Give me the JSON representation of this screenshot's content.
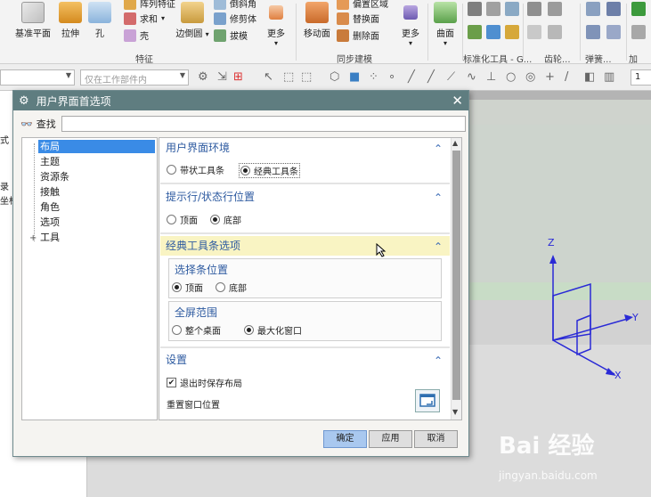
{
  "ribbon": {
    "feature_group": {
      "label": "特征",
      "buttons": [
        "基准平面",
        "拉伸",
        "孔",
        "边倒圆",
        "更多"
      ],
      "small_buttons": [
        "阵列特征",
        "求和",
        "壳",
        "倒斜角",
        "修剪体",
        "拔模"
      ]
    },
    "sync_group": {
      "label": "同步建模",
      "buttons": [
        "移动面",
        "更多"
      ],
      "small_buttons": [
        "偏置区域",
        "替换面",
        "删除面"
      ]
    },
    "surface_group": {
      "buttons": [
        "曲面"
      ]
    },
    "other_groups": [
      "标准化工具 - G...",
      "齿轮...",
      "弹簧...",
      "加工..."
    ]
  },
  "toolbar2": {
    "filter_combo": "",
    "scope_combo": "仅在工作部件内",
    "right_field": "1"
  },
  "left_panel": {
    "fragments": [
      "式",
      "录",
      "坐标"
    ]
  },
  "dialog": {
    "title": "用户界面首选项",
    "find_label": "查找",
    "find_value": "",
    "tree": [
      {
        "label": "布局",
        "selected": true
      },
      {
        "label": "主题",
        "selected": false
      },
      {
        "label": "资源条",
        "selected": false
      },
      {
        "label": "接触",
        "selected": false
      },
      {
        "label": "角色",
        "selected": false
      },
      {
        "label": "选项",
        "selected": false
      },
      {
        "label": "工具",
        "selected": false,
        "expandable": true
      }
    ],
    "sections": {
      "ui_env": {
        "title": "用户界面环境",
        "options": [
          "带状工具条",
          "经典工具条"
        ],
        "selected": "经典工具条"
      },
      "prompt": {
        "title": "提示行/状态行位置",
        "options": [
          "顶面",
          "底部"
        ],
        "selected": "底部"
      },
      "classic": {
        "title": "经典工具条选项",
        "selection_bar": {
          "title": "选择条位置",
          "options": [
            "顶面",
            "底部"
          ],
          "selected": "顶面"
        },
        "fullscreen": {
          "title": "全屏范围",
          "options": [
            "整个桌面",
            "最大化窗口"
          ],
          "selected": "最大化窗口"
        }
      },
      "settings": {
        "title": "设置",
        "save_on_exit": "退出时保存布局",
        "save_on_exit_checked": true,
        "reset_label": "重置窗口位置"
      }
    },
    "buttons": {
      "ok": "确定",
      "apply": "应用",
      "cancel": "取消"
    }
  },
  "viewport": {
    "axes": [
      "Z",
      "Y",
      "X"
    ],
    "axis_color": "#2a2ad6"
  },
  "watermark": {
    "brand": "Bai 经验",
    "url": "jingyan.baidu.com"
  }
}
